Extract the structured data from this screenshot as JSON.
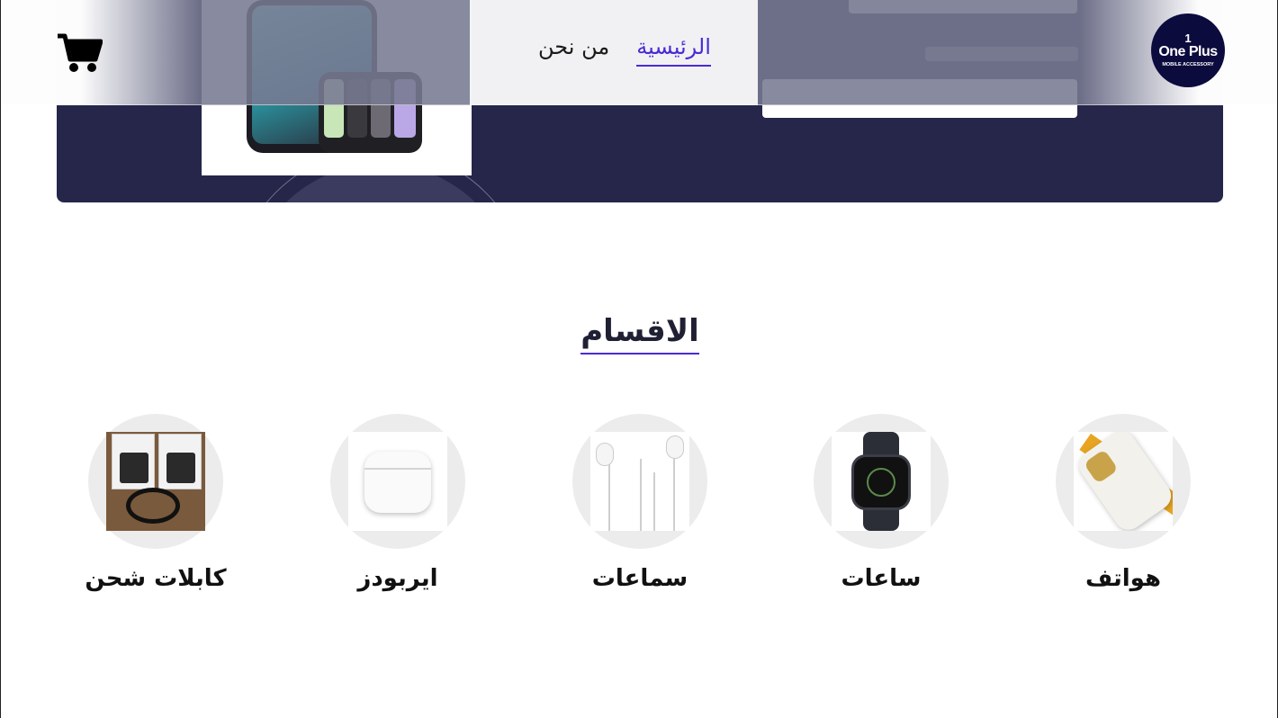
{
  "header": {
    "nav": [
      {
        "label": "الرئيسية",
        "active": true
      },
      {
        "label": "من نحن",
        "active": false
      }
    ],
    "logo": {
      "line_top": "1",
      "brand": "One Plus",
      "tagline": "MOBILE ACCESSORY"
    },
    "cart_icon": "shopping-cart-icon"
  },
  "categories_section": {
    "title": "الاقسام",
    "items": [
      {
        "label": "هواتف",
        "image": "phone-case"
      },
      {
        "label": "ساعات",
        "image": "smart-watch"
      },
      {
        "label": "سماعات",
        "image": "wired-earphones"
      },
      {
        "label": "ايربودز",
        "image": "airpods"
      },
      {
        "label": "كابلات شحن",
        "image": "charging-cables"
      }
    ]
  },
  "colors": {
    "accent": "#4a2bd6",
    "hero_bg": "#252649",
    "logo_bg": "#0c0b3e",
    "category_circle": "#ececec"
  }
}
